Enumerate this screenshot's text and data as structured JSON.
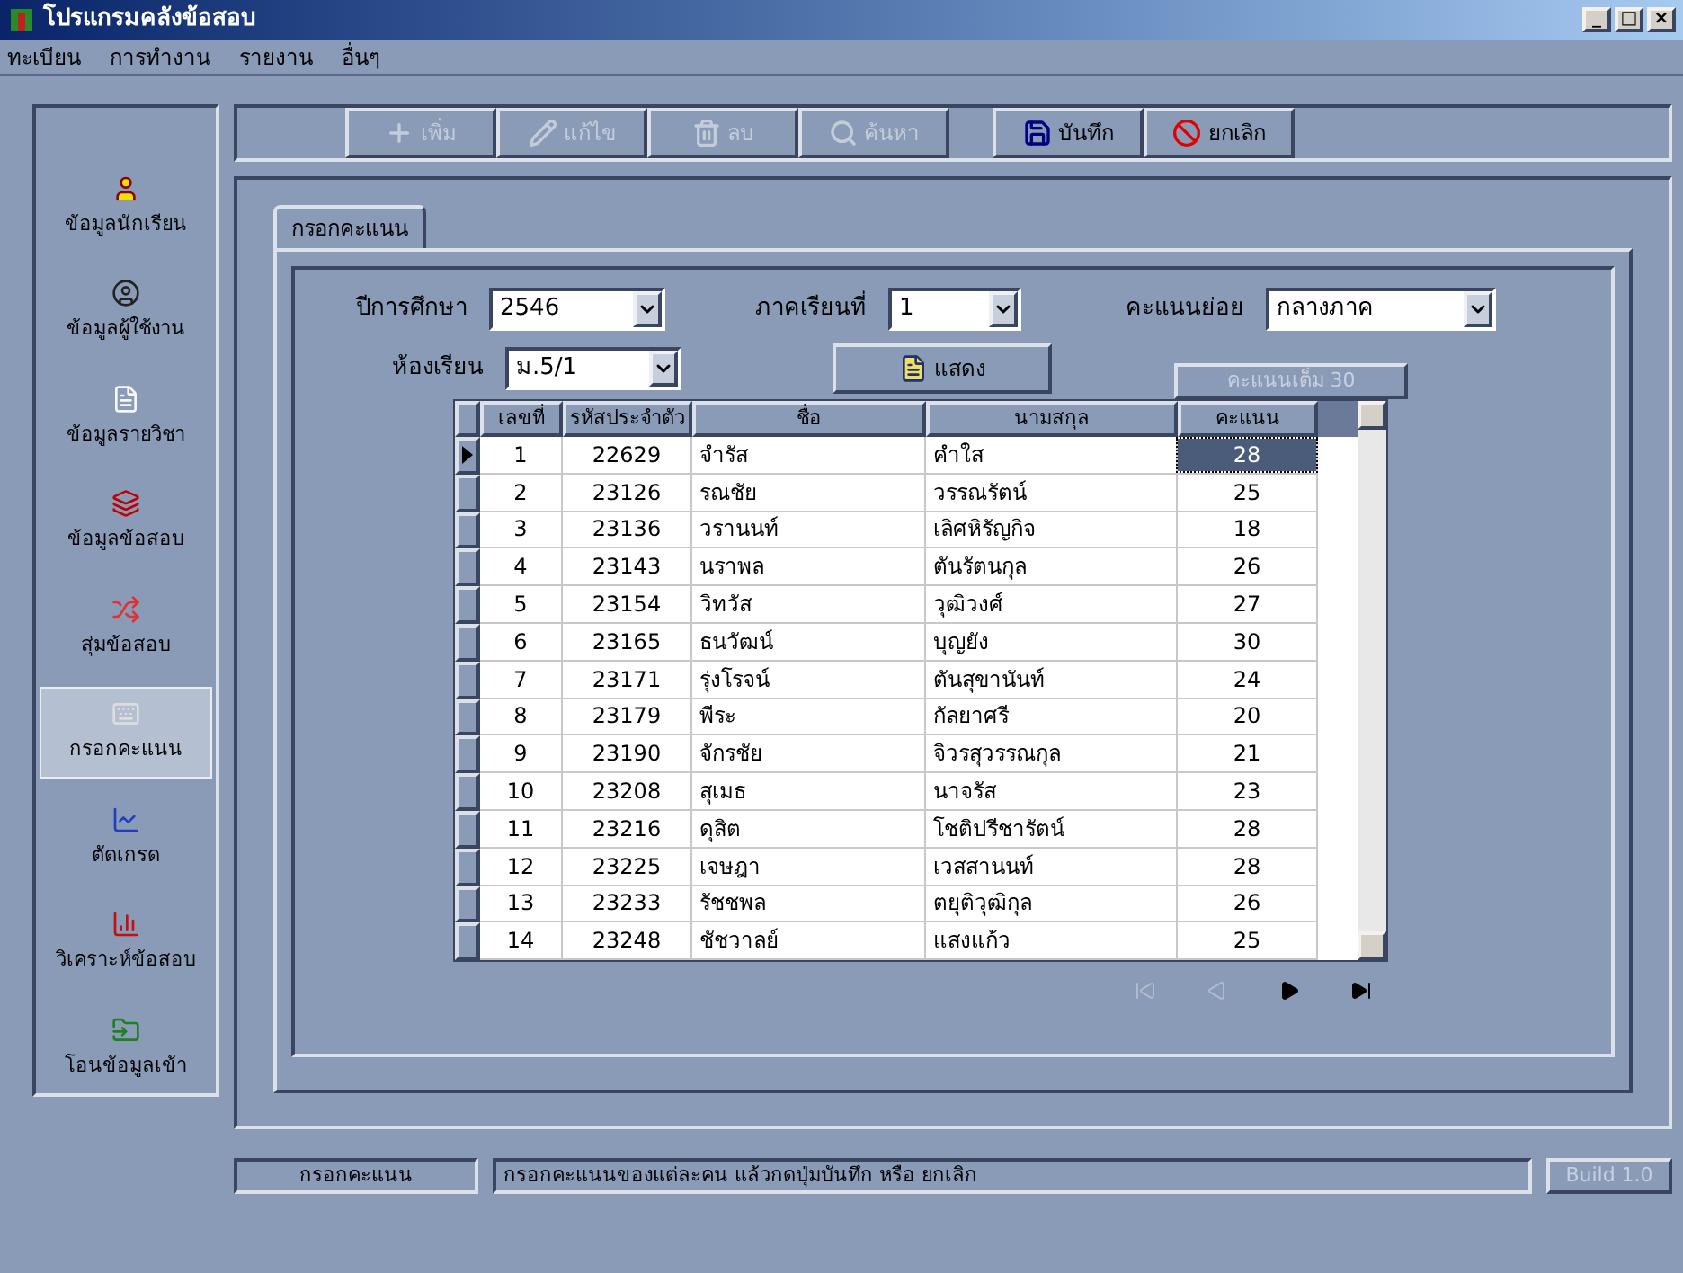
{
  "window": {
    "title": "โปรแกรมคลังข้อสอบ",
    "controls": [
      "_",
      "□",
      "×"
    ]
  },
  "menu": [
    "ทะเบียน",
    "การทำงาน",
    "รายงาน",
    "อื่นๆ"
  ],
  "sidebar": {
    "items": [
      {
        "label": "ข้อมูลนักเรียน",
        "selected": false
      },
      {
        "label": "ข้อมูลผู้ใช้งาน",
        "selected": false
      },
      {
        "label": "ข้อมูลรายวิชา",
        "selected": false
      },
      {
        "label": "ข้อมูลข้อสอบ",
        "selected": false
      },
      {
        "label": "สุ่มข้อสอบ",
        "selected": false
      },
      {
        "label": "กรอกคะแนน",
        "selected": true
      },
      {
        "label": "ตัดเกรด",
        "selected": false
      },
      {
        "label": "วิเคราะห์ข้อสอบ",
        "selected": false
      },
      {
        "label": "โอนข้อมูลเข้า",
        "selected": false
      }
    ]
  },
  "toolbar": {
    "groups": [
      [
        {
          "label": "เพิ่ม",
          "disabled": true
        },
        {
          "label": "แก้ไข",
          "disabled": true
        },
        {
          "label": "ลบ",
          "disabled": true
        },
        {
          "label": "ค้นหา",
          "disabled": true
        }
      ],
      [
        {
          "label": "บันทึก",
          "disabled": false
        },
        {
          "label": "ยกเลิก",
          "disabled": false
        }
      ]
    ]
  },
  "tabs": [
    {
      "label": "กรอกคะแนน",
      "selected": true
    }
  ],
  "filters": {
    "year": {
      "label": "ปีการศึกษา",
      "value": "2546"
    },
    "term": {
      "label": "ภาคเรียนที่",
      "value": "1"
    },
    "score_type": {
      "label": "คะแนนย่อย",
      "value": "กลางภาค"
    },
    "room": {
      "label": "ห้องเรียน",
      "value": "ม.5/1"
    },
    "show_button": "แสดง",
    "full_score": "คะแนนเต็ม 30"
  },
  "table": {
    "columns": [
      "เลขที่",
      "รหัสประจำตัว",
      "ชื่อ",
      "นามสกุล",
      "คะแนน"
    ],
    "rows": [
      {
        "cells": [
          "1",
          "22629",
          "จำรัส",
          "คำใส",
          "28"
        ],
        "selected": true
      },
      {
        "cells": [
          "2",
          "23126",
          "รณชัย",
          "วรรณรัตน์",
          "25"
        ],
        "selected": false
      },
      {
        "cells": [
          "3",
          "23136",
          "วรานนท์",
          "เลิศหิรัญกิจ",
          "18"
        ],
        "selected": false
      },
      {
        "cells": [
          "4",
          "23143",
          "นราพล",
          "ตันรัตนกุล",
          "26"
        ],
        "selected": false
      },
      {
        "cells": [
          "5",
          "23154",
          "วิทวัส",
          "วุฒิวงศ์",
          "27"
        ],
        "selected": false
      },
      {
        "cells": [
          "6",
          "23165",
          "ธนวัฒน์",
          "บุญยัง",
          "30"
        ],
        "selected": false
      },
      {
        "cells": [
          "7",
          "23171",
          "รุ่งโรจน์",
          "ตันสุขานันท์",
          "24"
        ],
        "selected": false
      },
      {
        "cells": [
          "8",
          "23179",
          "พีระ",
          "กัลยาศรี",
          "20"
        ],
        "selected": false
      },
      {
        "cells": [
          "9",
          "23190",
          "จักรชัย",
          "จิวรสุวรรณกุล",
          "21"
        ],
        "selected": false
      },
      {
        "cells": [
          "10",
          "23208",
          "สุเมธ",
          "นาจรัส",
          "23"
        ],
        "selected": false
      },
      {
        "cells": [
          "11",
          "23216",
          "ดุสิต",
          "โชติปรีชารัตน์",
          "28"
        ],
        "selected": false
      },
      {
        "cells": [
          "12",
          "23225",
          "เจษฎา",
          "เวสสานนท์",
          "28"
        ],
        "selected": false
      },
      {
        "cells": [
          "13",
          "23233",
          "รัชชพล",
          "ตยุติวุฒิกุล",
          "26"
        ],
        "selected": false
      },
      {
        "cells": [
          "14",
          "23248",
          "ชัชวาลย์",
          "แสงแก้ว",
          "25"
        ],
        "selected": false
      }
    ]
  },
  "navigator": [
    {
      "disabled": true
    },
    {
      "disabled": true
    },
    {
      "disabled": false
    },
    {
      "disabled": false
    }
  ],
  "status_bar": {
    "section": "กรอกคะแนน",
    "message": "กรอกคะแนนของแต่ละคน แล้วกดปุ่มบันทึก หรือ ยกเลิก",
    "build": "Build 1.0"
  }
}
